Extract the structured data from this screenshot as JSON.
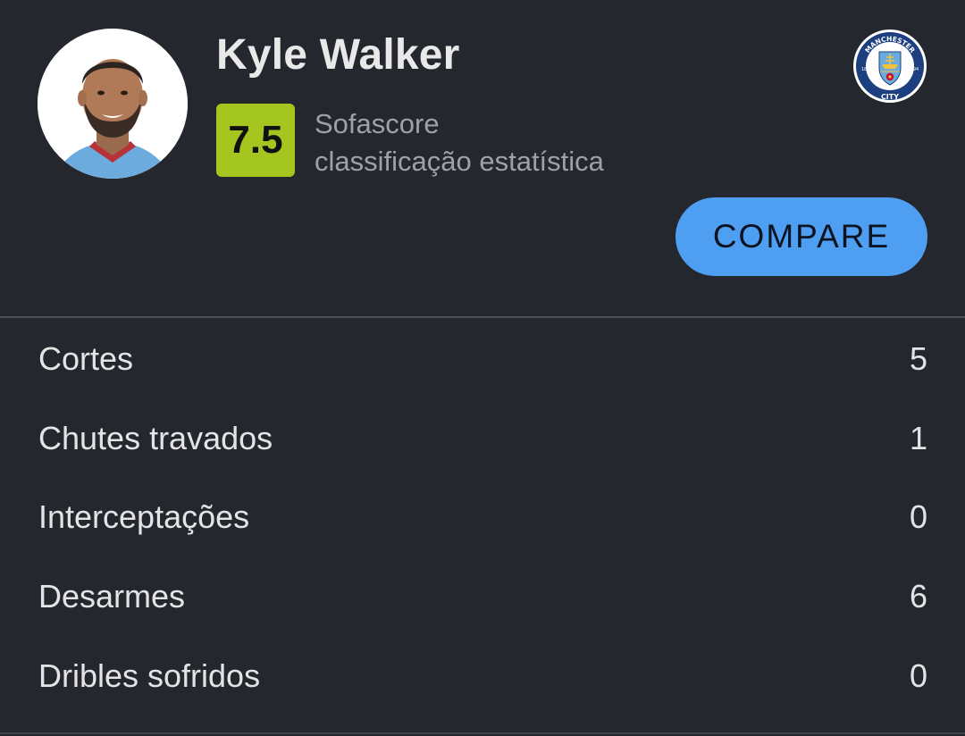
{
  "player": {
    "name": "Kyle Walker",
    "rating": "7.5",
    "rating_color": "#a4c61e",
    "rating_source_line1": "Sofascore",
    "rating_source_line2": "classificação estatística"
  },
  "club_crest": {
    "icon": "manchester-city-crest-icon",
    "text_top": "MANCHESTER",
    "text_bottom": "CITY",
    "year_left": "18",
    "year_right": "94"
  },
  "compare_button": {
    "label": "COMPARE",
    "color": "#4e9ff2"
  },
  "stats": [
    {
      "label": "Cortes",
      "value": "5"
    },
    {
      "label": "Chutes travados",
      "value": "1"
    },
    {
      "label": "Interceptações",
      "value": "0"
    },
    {
      "label": "Desarmes",
      "value": "6"
    },
    {
      "label": "Dribles sofridos",
      "value": "0"
    }
  ],
  "colors": {
    "background": "#24272d",
    "text": "#e4e4e6",
    "muted": "#9ea1a8"
  }
}
